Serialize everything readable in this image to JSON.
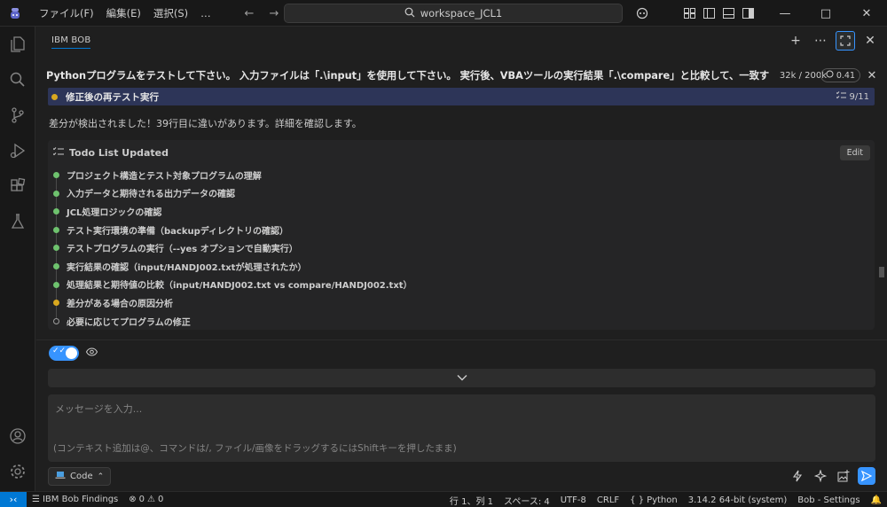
{
  "titlebar": {
    "menus": [
      "ファイル(F)",
      "編集(E)",
      "選択(S)",
      "…"
    ],
    "search_text": "workspace_JCL1",
    "window_controls": [
      "minimize-icon",
      "maximize-icon",
      "close-icon"
    ]
  },
  "activity_bar": {
    "icons": [
      "explorer-icon",
      "search-icon",
      "source-control-icon",
      "run-debug-icon",
      "extensions-icon",
      "testing-icon",
      "account-icon",
      "settings-gear-icon"
    ]
  },
  "panel": {
    "tab_label": "IBM BOB"
  },
  "task": {
    "title": "Pythonプログラムをテストして下さい。 入力ファイルは「.\\input」を使用して下さい。 実行後、VBAツールの実行結果「.\\compare」と比較して、一致するこ...",
    "tokens": "32k / 200k",
    "cost": "0.41"
  },
  "step": {
    "label": "修正後の再テスト実行",
    "count": "9/11"
  },
  "message": "差分が検出されました！39行目に違いがあります。詳細を確認します。",
  "todo": {
    "header": "Todo List Updated",
    "edit_label": "Edit",
    "items": [
      {
        "text": "プロジェクト構造とテスト対象プログラムの理解",
        "status": "done"
      },
      {
        "text": "入力データと期待される出力データの確認",
        "status": "done"
      },
      {
        "text": "JCL処理ロジックの確認",
        "status": "done"
      },
      {
        "text": "テスト実行環境の準備（backupディレクトリの確認）",
        "status": "done"
      },
      {
        "text": "テストプログラムの実行（--yes オプションで自動実行）",
        "status": "done"
      },
      {
        "text": "実行結果の確認（input/HANDJ002.txtが処理されたか）",
        "status": "done"
      },
      {
        "text": "処理結果と期待値の比較（input/HANDJ002.txt vs compare/HANDJ002.txt）",
        "status": "done"
      },
      {
        "text": "差分がある場合の原因分析",
        "status": "active"
      },
      {
        "text": "必要に応じてプログラムの修正",
        "status": "pending"
      }
    ]
  },
  "input": {
    "placeholder": "メッセージを入力...",
    "hint": "(コンテキスト追加は@、コマンドは/, ファイル/画像をドラッグするにはShiftキーを押したまま)"
  },
  "mode": {
    "label": "Code"
  },
  "statusbar": {
    "findings": "IBM Bob Findings",
    "errors": "0",
    "warnings": "0",
    "position": "行 1、列 1",
    "spaces": "スペース: 4",
    "encoding": "UTF-8",
    "eol": "CRLF",
    "language": "Python",
    "interpreter": "3.14.2 64-bit (system)",
    "settings": "Bob - Settings"
  },
  "colors": {
    "accent": "#0078d4",
    "step_bar": "#2d3558",
    "done": "#6ec26e",
    "active": "#d9a81f"
  }
}
